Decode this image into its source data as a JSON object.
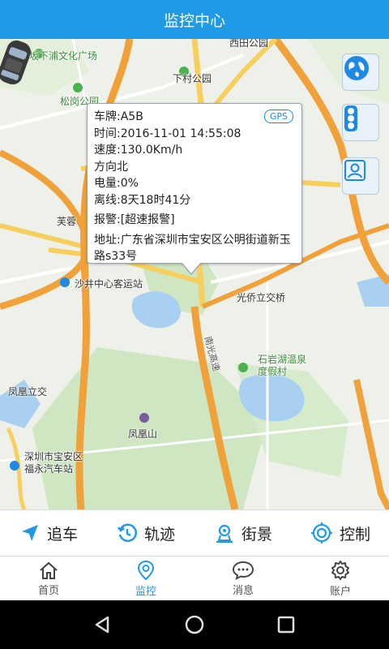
{
  "header": {
    "title": "监控中心"
  },
  "map": {
    "labels": {
      "wenhua": "坂下浦文化广场",
      "xicun": "西田公园",
      "xiacun": "下村公园",
      "songgang": "松岗公园",
      "furong": "芙蓉",
      "shajing": "沙井中心客运站",
      "guangqiao": "光侨立交桥",
      "shiyan": "石岩湖温泉度假村",
      "fenghuang_lijiao": "凤凰立交",
      "fenghuangshan": "凤凰山",
      "baoan_station": "深圳市宝安区福永汽车站",
      "nanguang": "南光高速"
    }
  },
  "popup": {
    "gps_badge": "GPS",
    "plate": "车牌:A5B",
    "time": "时间:2016-11-01 14:55:08",
    "speed": "速度:130.0Km/h",
    "direction": "方向北",
    "battery": "电量:0%",
    "offline": "离线:8天18时41分",
    "alarm": "报警:[超速报警]",
    "address": "地址:广东省深圳市宝安区公明街道新玉路s33号"
  },
  "actions": [
    {
      "label": "追车",
      "icon": "navigation-arrow-icon"
    },
    {
      "label": "轨迹",
      "icon": "history-clock-icon"
    },
    {
      "label": "街景",
      "icon": "street-view-icon"
    },
    {
      "label": "控制",
      "icon": "control-target-icon"
    }
  ],
  "tabs": [
    {
      "label": "首页",
      "icon": "home-icon",
      "active": false
    },
    {
      "label": "监控",
      "icon": "location-pin-icon",
      "active": true
    },
    {
      "label": "消息",
      "icon": "chat-bubble-icon",
      "active": false
    },
    {
      "label": "账户",
      "icon": "gear-icon",
      "active": false
    }
  ],
  "colors": {
    "accent": "#1e9ae6",
    "highway": "#f39c12",
    "road": "#fbd66e",
    "water": "#9cc7ef",
    "green": "#c8e3b8"
  }
}
